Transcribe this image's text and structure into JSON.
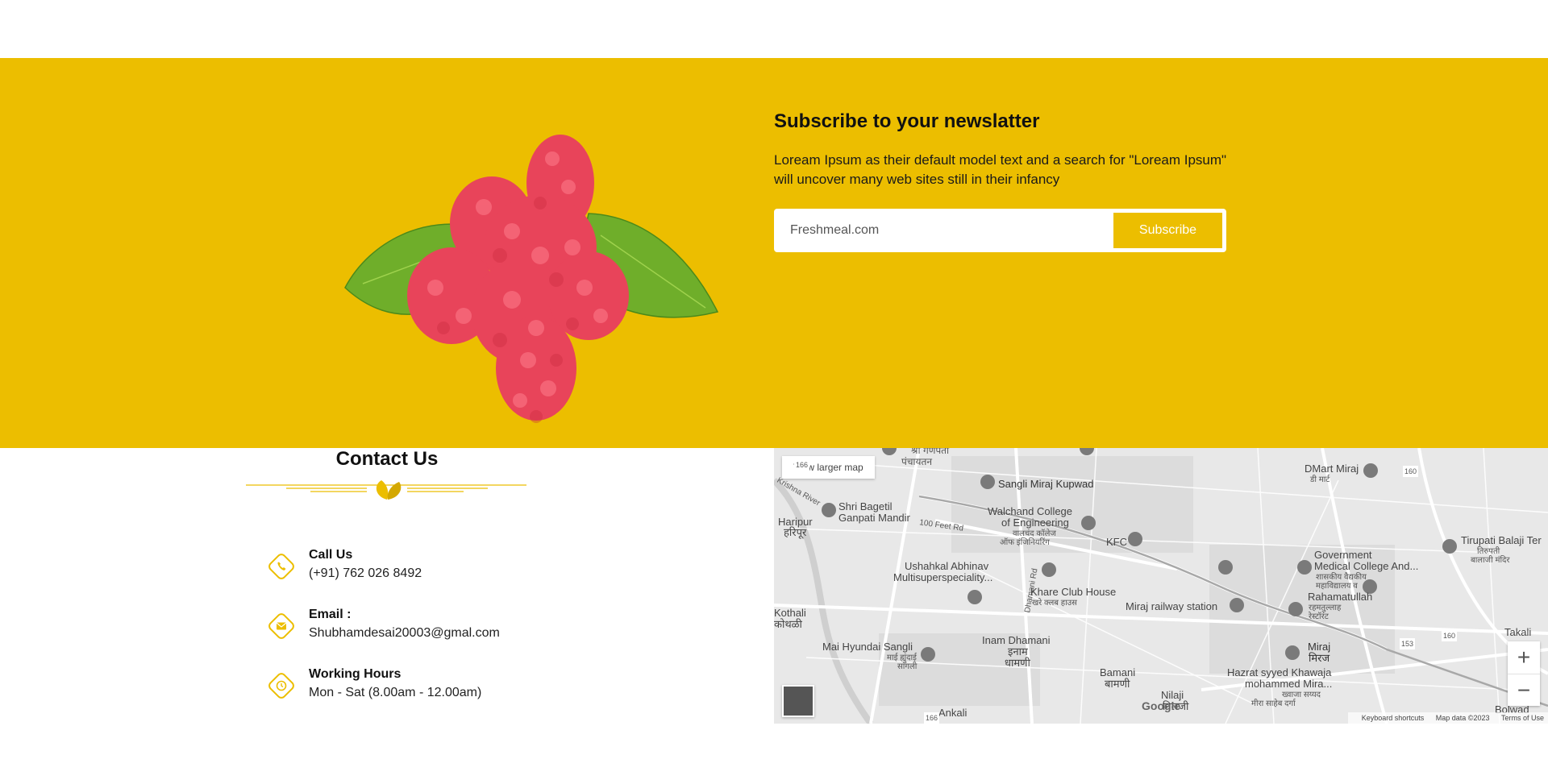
{
  "newsletter": {
    "title": "Subscribe to your newslatter",
    "description": "Loream Ipsum as their default model text and a search for \"Loream Ipsum\" will uncover many web sites still in their infancy",
    "input_placeholder": "Freshmeal.com",
    "button_label": "Subscribe",
    "background_color": "#ecbe00"
  },
  "contact": {
    "title": "Contact Us",
    "items": [
      {
        "icon": "phone-icon",
        "label": "Call Us",
        "value": "(+91) 762 026 8492"
      },
      {
        "icon": "envelope-icon",
        "label": "Email :",
        "value": "Shubhamdesai20003@gmal.com"
      },
      {
        "icon": "clock-icon",
        "label": "Working Hours",
        "value": "Mon - Sat (8.00am - 12.00am)"
      }
    ]
  },
  "map": {
    "view_larger_label": "View larger map",
    "zoom_in": "+",
    "zoom_out": "−",
    "google_logo": "Google",
    "attribution": {
      "shortcuts": "Keyboard shortcuts",
      "data": "Map data ©2023",
      "terms": "Terms of Use"
    },
    "places": {
      "sangli_miraj": "Sangli Miraj Kupwad",
      "dmart": "DMart Miraj",
      "dmart_mr": "डी मार्ट",
      "shri_bagetil": "Shri Bagetil",
      "ganpati": "Ganpati Mandir",
      "haripur": "Haripur",
      "haripur_mr": "हरिपूर",
      "walchand": "Walchand College",
      "walchand2": "of Engineering",
      "walchand_mr": "वालचंद कॉलेज",
      "walchand_mr2": "ऑफ इंजिनियरिंग",
      "feet_rd": "100 Feet Rd",
      "kfc": "KFC",
      "govt_medical": "Government",
      "govt_medical2": "Medical College And...",
      "govt_medical_mr": "शासकीय वैद्यकीय",
      "govt_medical_mr2": "महाविद्यालय व",
      "tirupati": "Tirupati Balaji Ter",
      "tirupati_mr": "तिरुपती",
      "tirupati_mr2": "बालाजी मंदिर",
      "ushahkal": "Ushahkal Abhinav",
      "ushahkal2": "Multisuperspeciality...",
      "dhamani_rd": "Dhamani Rd",
      "khare": "Khare Club House",
      "khare_mr": "खरे क्लब हाउस",
      "miraj_rail": "Miraj railway station",
      "rahamatullah": "Rahamatullah",
      "rahamatullah_mr": "रहमतुल्लाह",
      "rahamatullah_mr2": "रेस्टॉरंट",
      "kothali": "Kothali",
      "kothali_mr": "कोथळी",
      "mai_hyundai": "Mai Hyundai Sangli",
      "mai_hyundai_mr": "माई ह्युंदाई",
      "mai_hyundai_mr2": "सांगली",
      "inam": "Inam Dhamani",
      "inam_mr": "इनाम",
      "inam_mr2": "धामणी",
      "miraj": "Miraj",
      "miraj_mr": "मिरज",
      "takali": "Takali",
      "bamani": "Bamani",
      "bamani_mr": "बामणी",
      "hazrat": "Hazrat syyed Khawaja",
      "hazrat2": "mohammed Mira...",
      "hazrat_mr": "ख्वाजा सय्यद",
      "hazrat_mr2": "मीरा साहेब दर्गा",
      "nilaji": "Nilaji",
      "nilaji_mr": "निलजी",
      "ankali": "Ankali",
      "bolwad": "Bolwad",
      "rd_166": "166",
      "rd_160": "160",
      "rd_153": "153",
      "panchayat": "श्री गणपती",
      "panchayat2": "पंचायतन",
      "krishna": "Krishna River"
    }
  }
}
